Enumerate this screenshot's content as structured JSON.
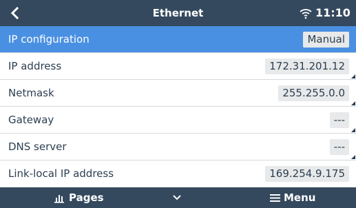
{
  "header": {
    "title": "Ethernet",
    "time": "11:10",
    "back_icon": "chevron-left-icon",
    "status_icon": "wifi-icon"
  },
  "settings": [
    {
      "label": "IP configuration",
      "value": "Manual",
      "selected": true
    },
    {
      "label": "IP address",
      "value": "172.31.201.12"
    },
    {
      "label": "Netmask",
      "value": "255.255.0.0"
    },
    {
      "label": "Gateway",
      "value": "---"
    },
    {
      "label": "DNS server",
      "value": "---"
    },
    {
      "label": "Link-local IP address",
      "value": "169.254.9.175"
    }
  ],
  "footer": {
    "pages_label": "Pages",
    "menu_label": "Menu",
    "pages_icon": "bar-chart-icon",
    "center_icon": "chevron-down-icon",
    "menu_icon": "hamburger-icon"
  },
  "colors": {
    "bar": "#34495e",
    "selected_row": "#4a90e2",
    "value_box": "#e7e9ea",
    "text": "#2c3e50"
  }
}
